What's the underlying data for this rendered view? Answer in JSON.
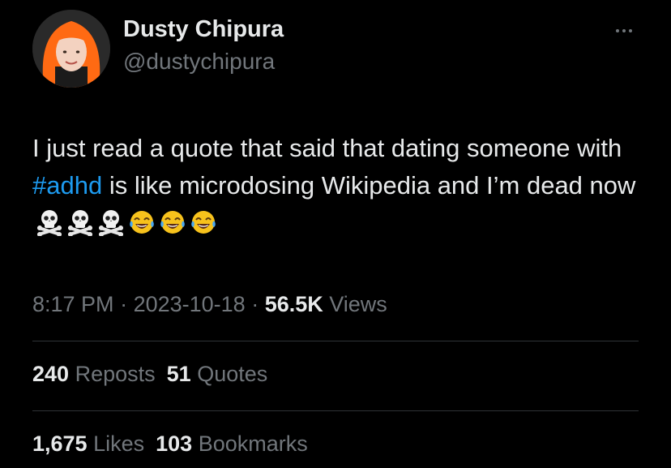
{
  "author": {
    "display_name": "Dusty Chipura",
    "handle": "@dustychipura"
  },
  "tweet": {
    "text_before": "I just read a quote that said that dating someone with ",
    "hashtag": "#adhd",
    "text_after": " is like microdosing Wikipedia and I’m dead now",
    "emojis": [
      "skull-crossbones-icon",
      "skull-crossbones-icon",
      "skull-crossbones-icon",
      "tears-of-joy-icon",
      "tears-of-joy-icon",
      "tears-of-joy-icon"
    ]
  },
  "meta": {
    "time": "8:17 PM",
    "separator": " · ",
    "date": "2023-10-18",
    "views_count": "56.5K",
    "views_label": "Views"
  },
  "stats_row1": {
    "reposts_count": "240",
    "reposts_label": "Reposts",
    "quotes_count": "51",
    "quotes_label": "Quotes"
  },
  "stats_row2": {
    "likes_count": "1,675",
    "likes_label": "Likes",
    "bookmarks_count": "103",
    "bookmarks_label": "Bookmarks"
  },
  "colors": {
    "background": "#000000",
    "primary_text": "#e7e9ea",
    "secondary_text": "#71767b",
    "link": "#1d9bf0",
    "divider": "#2f3336",
    "avatar_hair": "#ff6a13"
  }
}
